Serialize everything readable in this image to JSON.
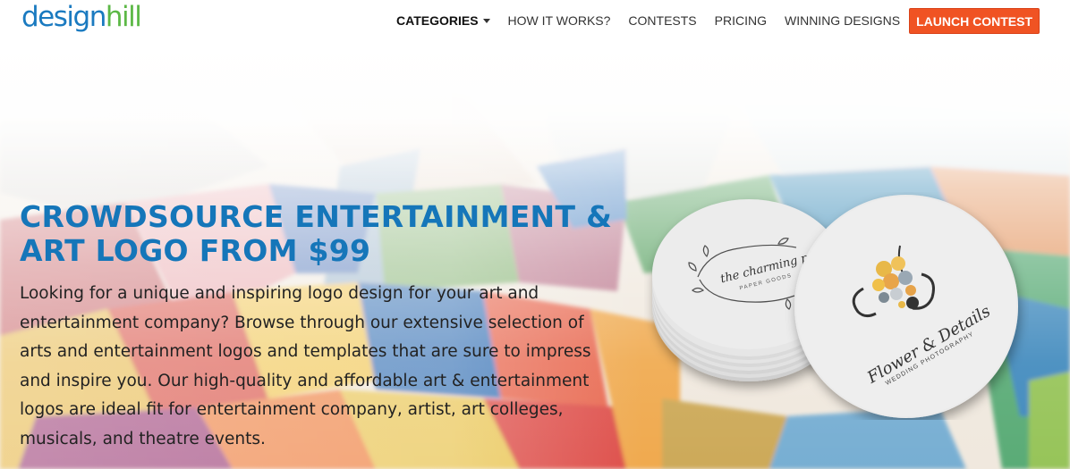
{
  "brand": {
    "logo_part1": "design",
    "logo_part2": "hill"
  },
  "nav": {
    "items": [
      {
        "label": "CATEGORIES",
        "has_dropdown": true
      },
      {
        "label": "HOW IT WORKS?"
      },
      {
        "label": "CONTESTS"
      },
      {
        "label": "PRICING"
      },
      {
        "label": "WINNING DESIGNS"
      }
    ],
    "cta_label": "LAUNCH CONTEST"
  },
  "hero": {
    "title_line1": "CROWDSOURCE ENTERTAINMENT &",
    "title_line2": "ART LOGO FROM $99",
    "description": "Looking for a unique and inspiring logo design for your art and entertainment company? Browse through our extensive selection of arts and entertainment logos and templates that are sure to impress and inspire you. Our high-quality and affordable art & entertainment logos are ideal fit for entertainment company, artist, art colleges, musicals, and theatre events."
  },
  "mockup": {
    "back_coaster_text": "the charming pr",
    "back_coaster_subtext": "PAPER GOODS",
    "front_coaster_text": "Flower & Details",
    "front_coaster_subtext": "WEDDING PHOTOGRAPHY"
  },
  "colors": {
    "brand_blue": "#1a7ac0",
    "brand_green": "#5cb846",
    "cta_orange": "#f05323",
    "title_blue": "#1576b9"
  }
}
